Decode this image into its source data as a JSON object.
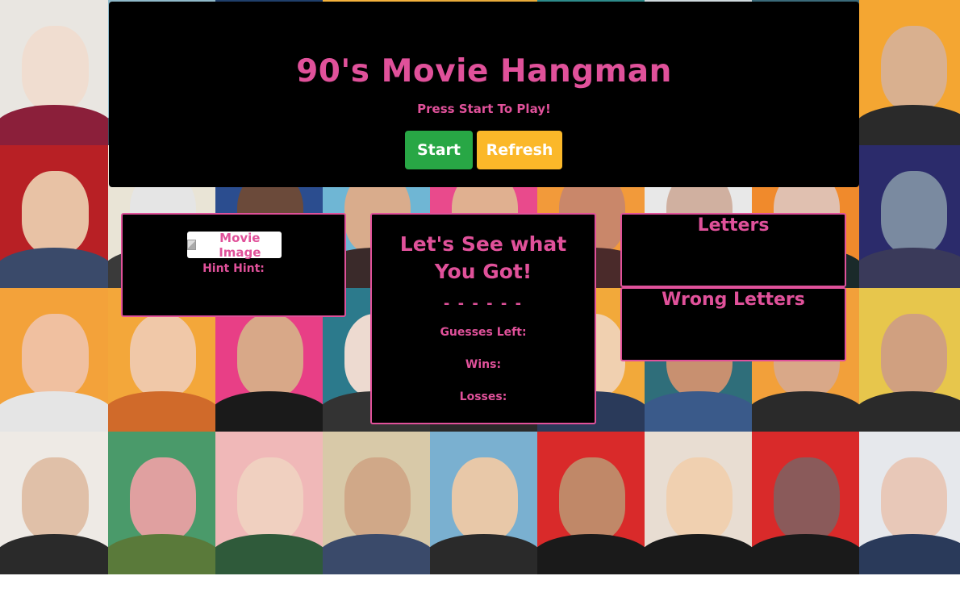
{
  "header": {
    "title": "90's Movie Hangman",
    "subtitle": "Press Start To Play!",
    "start_label": "Start",
    "refresh_label": "Refresh"
  },
  "image_panel": {
    "image_alt": "Movie Image",
    "hint_label": "Hint Hint:"
  },
  "game_panel": {
    "heading_line1": "Let's See what",
    "heading_line2": "You Got!",
    "blanks": "- - - - - -",
    "guesses_label": "Guesses Left:",
    "wins_label": "Wins:",
    "losses_label": "Losses:"
  },
  "letters_panel": {
    "title": "Letters"
  },
  "wrong_panel": {
    "title": "Wrong Letters"
  },
  "colors": {
    "accent": "#e0519a",
    "start_button": "#28a745",
    "refresh_button": "#fbb829",
    "panel_bg": "#000000"
  },
  "background_tiles": [
    {
      "bg": "#e9e6e1",
      "head": "#f0ddd0",
      "body": "#8b1f3a"
    },
    {
      "bg": "#8fb9c9",
      "head": "#e8d7c8",
      "body": "#3a4a5a"
    },
    {
      "bg": "#1f3f6b",
      "head": "#7a4b35",
      "body": "#1a1a1a"
    },
    {
      "bg": "#f4b23c",
      "head": "#c9a27f",
      "body": "#2a2a2a"
    },
    {
      "bg": "#e8ab3a",
      "head": "#e8c2a0",
      "body": "#4a3a2a"
    },
    {
      "bg": "#2d8b8b",
      "head": "#d8b596",
      "body": "#3a2a2a"
    },
    {
      "bg": "#cfd9dd",
      "head": "#e0c0a8",
      "body": "#444444"
    },
    {
      "bg": "#3a6a7a",
      "head": "#a07060",
      "body": "#222222"
    },
    {
      "bg": "#f4a632",
      "head": "#d9b08f",
      "body": "#2a2a2a"
    },
    {
      "bg": "#cfcac0",
      "head": "#e2b494",
      "body": "#b02a2a"
    },
    {
      "bg": "#b82025",
      "head": "#e8c2a5",
      "body": "#3a4a6a"
    },
    {
      "bg": "#e9e4d6",
      "head": "#e5e5e5",
      "body": "#3a3a3a"
    },
    {
      "bg": "#2b4d8f",
      "head": "#6b4a3a",
      "body": "#1a1a1a"
    },
    {
      "bg": "#6fb6d4",
      "head": "#d9ac8c",
      "body": "#3a2a2a"
    },
    {
      "bg": "#e94a8c",
      "head": "#e0b090",
      "body": "#5a2a2a"
    },
    {
      "bg": "#f29a3a",
      "head": "#c9876a",
      "body": "#4a2a2a"
    },
    {
      "bg": "#e8e8e8",
      "head": "#d0b0a0",
      "body": "#222222"
    },
    {
      "bg": "#f08a2c",
      "head": "#e0c0b0",
      "body": "#1a2a2a"
    },
    {
      "bg": "#2b2b6b",
      "head": "#7a8aa0",
      "body": "#3a3a5a"
    },
    {
      "bg": "#3a5fa8",
      "head": "#c99070",
      "body": "#2a2a2a"
    },
    {
      "bg": "#f3a23a",
      "head": "#f0c0a0",
      "body": "#e5e5e5"
    },
    {
      "bg": "#f3a73a",
      "head": "#f0c8a8",
      "body": "#d06a2a"
    },
    {
      "bg": "#e83f86",
      "head": "#d8a888",
      "body": "#1a1a1a"
    },
    {
      "bg": "#2c7a8c",
      "head": "#eddad0",
      "body": "#333333"
    },
    {
      "bg": "#f5d33a",
      "head": "#e0c0a0",
      "body": "#2a2a2a"
    },
    {
      "bg": "#f2a93a",
      "head": "#f0d0b0",
      "body": "#2a3a5a"
    },
    {
      "bg": "#2f6e7a",
      "head": "#c89070",
      "body": "#3a5a8a"
    },
    {
      "bg": "#f2a03a",
      "head": "#d9a888",
      "body": "#2a2a2a"
    },
    {
      "bg": "#e7c64c",
      "head": "#d0a080",
      "body": "#2a2a2a"
    },
    {
      "bg": "#d92a2a",
      "head": "#e0c0b0",
      "body": "#5a4a3a"
    },
    {
      "bg": "#eeeae5",
      "head": "#e0c0a8",
      "body": "#2a2a2a"
    },
    {
      "bg": "#4a9a6a",
      "head": "#e0a0a0",
      "body": "#5a7a3a"
    },
    {
      "bg": "#f0b8b8",
      "head": "#f0d0c0",
      "body": "#2f5a3a"
    },
    {
      "bg": "#d8c9a8",
      "head": "#d0a888",
      "body": "#3a4a6a"
    },
    {
      "bg": "#7ab0d0",
      "head": "#e8c8a8",
      "body": "#2a2a2a"
    },
    {
      "bg": "#d92a2a",
      "head": "#c08868",
      "body": "#1a1a1a"
    },
    {
      "bg": "#e8ddd2",
      "head": "#f0d0b0",
      "body": "#1a1a1a"
    },
    {
      "bg": "#d92a2a",
      "head": "#8a5a5a",
      "body": "#1a1a1a"
    },
    {
      "bg": "#e6e8ec",
      "head": "#e8c8b8",
      "body": "#2a3a5a"
    },
    {
      "bg": "#2c6ab0",
      "head": "#e0c0b0",
      "body": "#3a3a3a"
    }
  ]
}
